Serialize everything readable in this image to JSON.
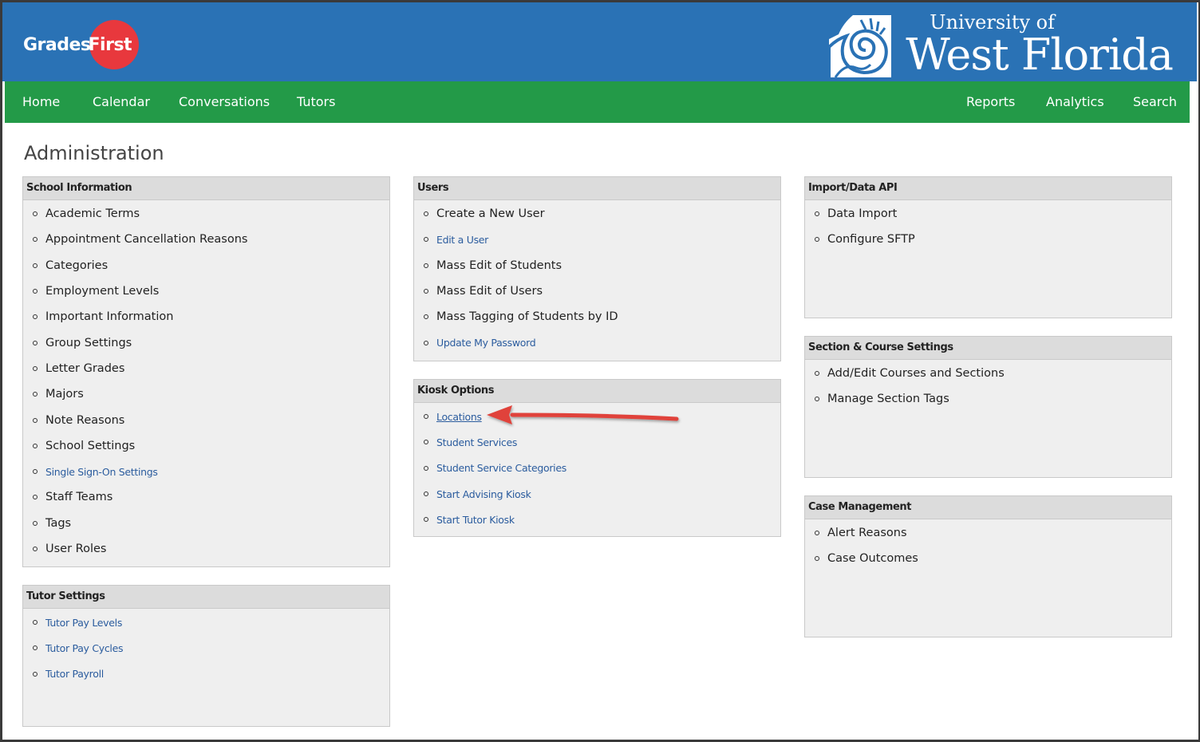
{
  "header": {
    "gradesfirst_logo": {
      "part1": "Grades",
      "part2": "First"
    },
    "university_logo": {
      "line1": "University of",
      "line2": "West Florida"
    },
    "colors": {
      "header_bg": "#2a72b5",
      "nav_bg": "#239a48",
      "logo_circle": "#e8383d",
      "link": "#2b5c9e",
      "arrow": "#e0433a"
    }
  },
  "nav": {
    "left": [
      "Home",
      "Calendar",
      "Conversations",
      "Tutors"
    ],
    "right": [
      "Reports",
      "Analytics",
      "Search"
    ]
  },
  "page": {
    "title": "Administration"
  },
  "panels": {
    "school_information": {
      "title": "School Information",
      "items": [
        {
          "label": "Academic Terms",
          "style": "plain"
        },
        {
          "label": "Appointment Cancellation Reasons",
          "style": "plain"
        },
        {
          "label": "Categories",
          "style": "plain"
        },
        {
          "label": "Employment Levels",
          "style": "plain"
        },
        {
          "label": "Important Information",
          "style": "plain"
        },
        {
          "label": "Group Settings",
          "style": "plain"
        },
        {
          "label": "Letter Grades",
          "style": "plain"
        },
        {
          "label": "Majors",
          "style": "plain"
        },
        {
          "label": "Note Reasons",
          "style": "plain"
        },
        {
          "label": "School Settings",
          "style": "plain"
        },
        {
          "label": "Single Sign-On Settings",
          "style": "link"
        },
        {
          "label": "Staff Teams",
          "style": "plain"
        },
        {
          "label": "Tags",
          "style": "plain"
        },
        {
          "label": "User Roles",
          "style": "plain"
        }
      ]
    },
    "tutor_settings": {
      "title": "Tutor Settings",
      "items": [
        {
          "label": "Tutor Pay Levels",
          "style": "link"
        },
        {
          "label": "Tutor Pay Cycles",
          "style": "link"
        },
        {
          "label": "Tutor Payroll",
          "style": "link"
        }
      ]
    },
    "users": {
      "title": "Users",
      "items": [
        {
          "label": "Create a New User",
          "style": "plain"
        },
        {
          "label": "Edit a User",
          "style": "link"
        },
        {
          "label": "Mass Edit of Students",
          "style": "plain"
        },
        {
          "label": "Mass Edit of Users",
          "style": "plain"
        },
        {
          "label": "Mass Tagging of Students by ID",
          "style": "plain"
        },
        {
          "label": "Update My Password",
          "style": "link"
        }
      ]
    },
    "kiosk_options": {
      "title": "Kiosk Options",
      "items": [
        {
          "label": "Locations",
          "style": "link-underline"
        },
        {
          "label": "Student Services",
          "style": "link"
        },
        {
          "label": "Student Service Categories",
          "style": "link"
        },
        {
          "label": "Start Advising Kiosk",
          "style": "link"
        },
        {
          "label": "Start Tutor Kiosk",
          "style": "link"
        }
      ]
    },
    "import_data_api": {
      "title": "Import/Data API",
      "items": [
        {
          "label": "Data Import",
          "style": "plain"
        },
        {
          "label": "Configure SFTP",
          "style": "plain"
        }
      ]
    },
    "section_course_settings": {
      "title": "Section & Course Settings",
      "items": [
        {
          "label": "Add/Edit Courses and Sections",
          "style": "plain"
        },
        {
          "label": "Manage Section Tags",
          "style": "plain"
        }
      ]
    },
    "case_management": {
      "title": "Case Management",
      "items": [
        {
          "label": "Alert Reasons",
          "style": "plain"
        },
        {
          "label": "Case Outcomes",
          "style": "plain"
        }
      ]
    }
  }
}
